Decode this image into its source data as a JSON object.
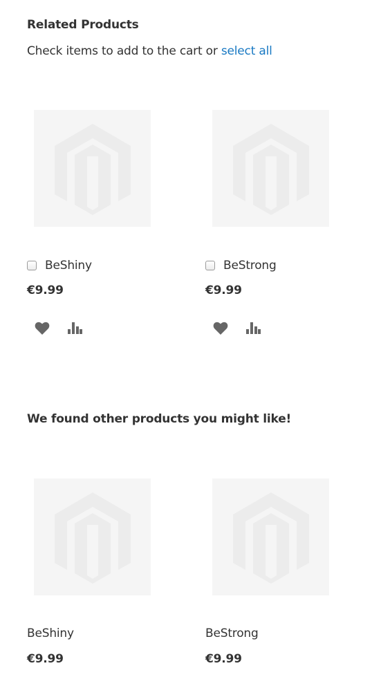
{
  "related": {
    "title": "Related Products",
    "helper_text": "Check items to add to the cart or",
    "select_all_label": "select all",
    "products": [
      {
        "name": "BeShiny",
        "price": "€9.99"
      },
      {
        "name": "BeStrong",
        "price": "€9.99"
      }
    ]
  },
  "upsell": {
    "title": "We found other products you might like!",
    "products": [
      {
        "name": "BeShiny",
        "price": "€9.99"
      },
      {
        "name": "BeStrong",
        "price": "€9.99"
      }
    ]
  },
  "icons": {
    "placeholder": "magento-placeholder-icon",
    "wishlist": "heart-icon",
    "compare": "bar-chart-icon"
  },
  "colors": {
    "text": "#333333",
    "link": "#1979c3",
    "icon": "#666666",
    "placeholder_bg": "#f5f5f5"
  }
}
